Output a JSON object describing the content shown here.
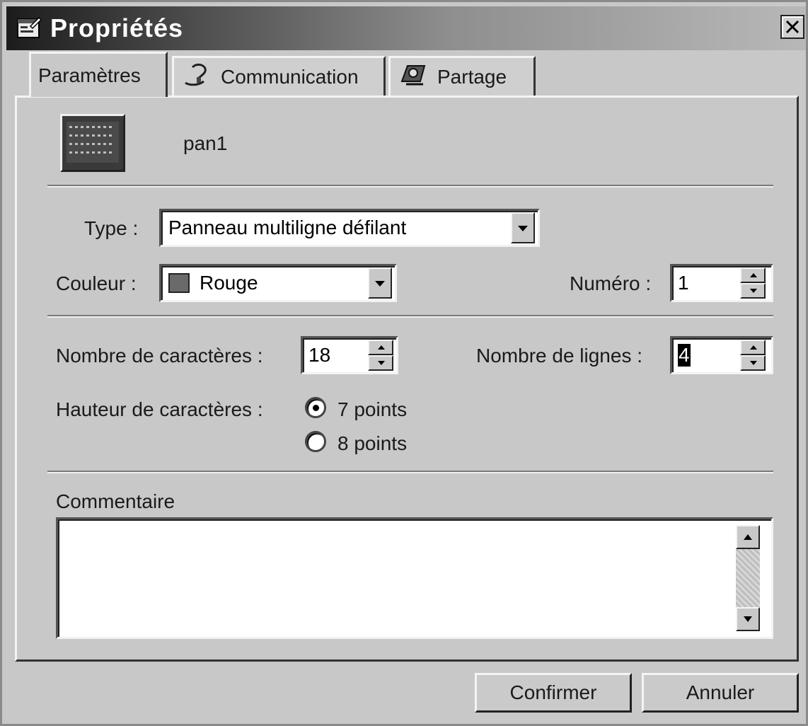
{
  "window": {
    "title": "Propriétés",
    "title_icon": "properties-icon",
    "close_icon": "close-icon"
  },
  "tabs": [
    {
      "label": "Paramètres",
      "icon": null,
      "active": true
    },
    {
      "label": "Communication",
      "icon": "modem-icon",
      "active": false
    },
    {
      "label": "Partage",
      "icon": "share-icon",
      "active": false
    }
  ],
  "panel": {
    "icon": "panel-display-icon",
    "name": "pan1"
  },
  "fields": {
    "type_label": "Type :",
    "type_value": "Panneau multiligne défilant",
    "color_label": "Couleur :",
    "color_value": "Rouge",
    "color_swatch": "#6a6a6a",
    "numero_label": "Numéro :",
    "numero_value": "1",
    "chars_label": "Nombre de caractères :",
    "chars_value": "18",
    "lines_label": "Nombre de lignes :",
    "lines_value": "4",
    "height_label": "Hauteur de caractères :",
    "height_options": [
      "7 points",
      "8 points"
    ],
    "height_selected": "7 points",
    "comment_label": "Commentaire",
    "comment_value": ""
  },
  "buttons": {
    "confirm": "Confirmer",
    "cancel": "Annuler"
  }
}
